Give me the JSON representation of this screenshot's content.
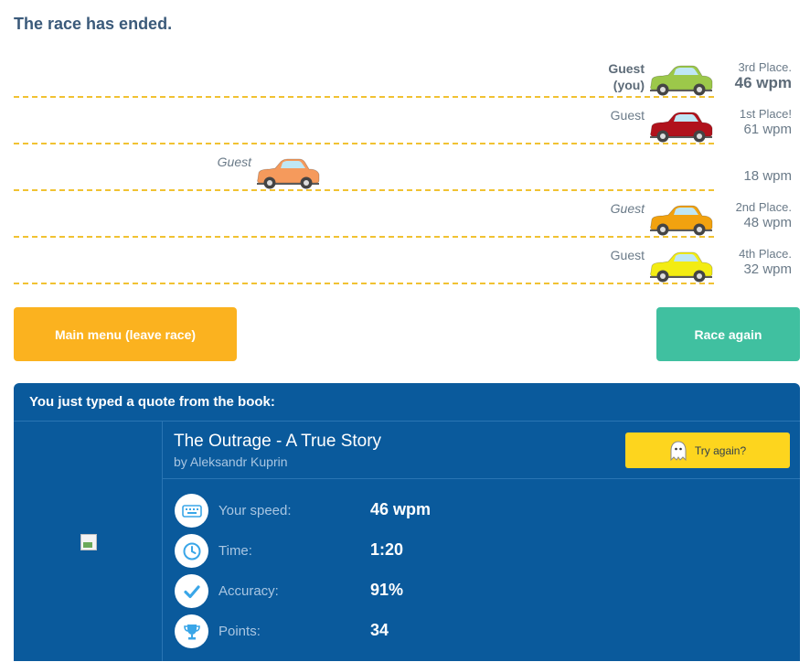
{
  "status": "The race has ended.",
  "colors": {
    "track_line": "#f1c232",
    "main_button": "#fbb21f",
    "again_button": "#40c0a0",
    "panel": "#0a5a9c",
    "try_button": "#fdd51e"
  },
  "racers": [
    {
      "name": "Guest",
      "name_sub": "(you)",
      "is_you": true,
      "italic": false,
      "car_color": "#9cc84a",
      "progress": 1.0,
      "place": "3rd Place.",
      "wpm": "46 wpm"
    },
    {
      "name": "Guest",
      "name_sub": "",
      "is_you": false,
      "italic": false,
      "car_color": "#b1121c",
      "progress": 1.0,
      "place": "1st Place!",
      "wpm": "61 wpm"
    },
    {
      "name": "Guest",
      "name_sub": "",
      "is_you": false,
      "italic": true,
      "car_color": "#f59a5c",
      "progress": 0.38,
      "place": "",
      "wpm": "18 wpm"
    },
    {
      "name": "Guest",
      "name_sub": "",
      "is_you": false,
      "italic": true,
      "car_color": "#f2a20f",
      "progress": 1.0,
      "place": "2nd Place.",
      "wpm": "48 wpm"
    },
    {
      "name": "Guest",
      "name_sub": "",
      "is_you": false,
      "italic": false,
      "car_color": "#f3ec13",
      "progress": 1.0,
      "place": "4th Place.",
      "wpm": "32 wpm"
    }
  ],
  "buttons": {
    "main_menu": "Main menu (leave race)",
    "race_again": "Race again"
  },
  "quote_panel": {
    "header": "You just typed a quote from the book:",
    "book_title": "The Outrage - A True Story",
    "book_author": "by Aleksandr Kuprin",
    "try_again": "Try again?",
    "try_again_icon": "ghost-icon",
    "stats": [
      {
        "icon": "keyboard-icon",
        "label": "Your speed:",
        "value": "46 wpm"
      },
      {
        "icon": "clock-icon",
        "label": "Time:",
        "value": "1:20"
      },
      {
        "icon": "checkmark-icon",
        "label": "Accuracy:",
        "value": "91%"
      },
      {
        "icon": "trophy-icon",
        "label": "Points:",
        "value": "34"
      }
    ]
  }
}
